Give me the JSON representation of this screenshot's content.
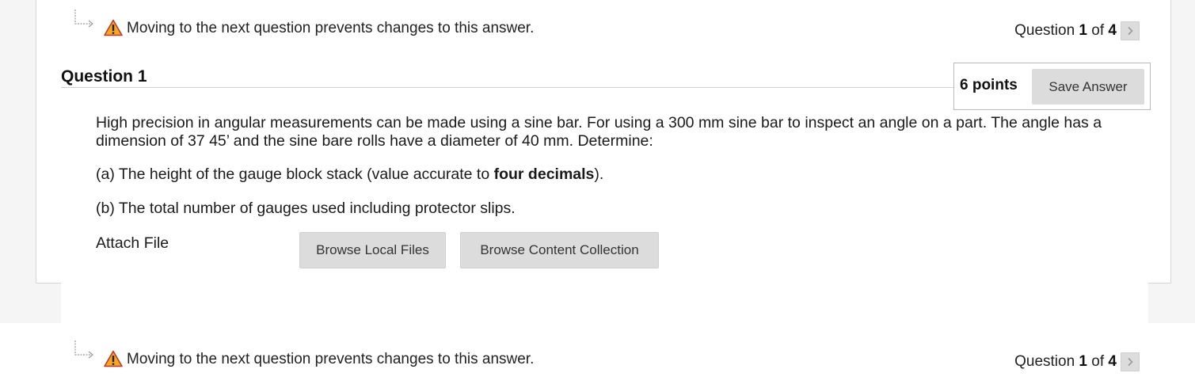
{
  "nav": {
    "warning_text": "Moving to the next question prevents changes to this answer.",
    "question_prefix": "Question",
    "current": "1",
    "of_word": "of",
    "total": "4"
  },
  "question": {
    "title": "Question 1",
    "points": "6 points",
    "save_label": "Save Answer",
    "body_paragraph_1": "High precision in angular measurements can be made using a sine bar. For using a 300 mm sine bar to inspect an angle on a part. The angle has a dimension of 37 45’ and the sine bare rolls have a diameter of 40 mm. Determine:",
    "part_a_prefix": "(a) The height of the gauge block stack (value accurate to ",
    "part_a_bold": "four decimals",
    "part_a_suffix": ").",
    "part_b": "(b) The total number of gauges used including protector slips."
  },
  "attach": {
    "label": "Attach File",
    "browse_local_label": "Browse Local Files",
    "browse_content_label": "Browse Content Collection"
  },
  "icons": {
    "warning": "warning-triangle-icon",
    "arrow": "return-arrow-icon",
    "next": "chevron-right-icon"
  },
  "colors": {
    "warning_fill": "#f5a623",
    "warning_stroke": "#c0392b",
    "button_bg": "#dcdcdc"
  }
}
